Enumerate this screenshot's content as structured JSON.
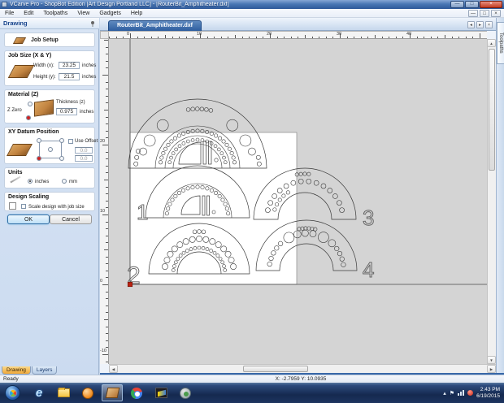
{
  "window": {
    "title": "VCarve Pro - ShopBot Edition [Art Design Portland LLC] - [RouterBit_Amphitheater.dxf]",
    "menus": [
      "File",
      "Edit",
      "Toolpaths",
      "View",
      "Gadgets",
      "Help"
    ],
    "controls": {
      "minimize": "—",
      "maximize": "□",
      "close": "×"
    }
  },
  "panel": {
    "header": "Drawing",
    "job_setup_label": "Job Setup",
    "job_size": {
      "title": "Job Size (X & Y)",
      "width_label": "Width (x):",
      "width_value": "23.25",
      "height_label": "Height (y):",
      "height_value": "21.5",
      "units_label": "inches"
    },
    "material": {
      "title": "Material (Z)",
      "z_zero_label": "Z Zero",
      "thickness_label": "Thickness (z)",
      "thickness_value": "0.975",
      "units_label": "inches"
    },
    "datum": {
      "title": "XY Datum Position",
      "use_offset_label": "Use Offset",
      "x_offset_value": "0.0",
      "y_offset_value": "0.0"
    },
    "units": {
      "title": "Units",
      "inches_label": "inches",
      "mm_label": "mm"
    },
    "design_scaling": {
      "title": "Design Scaling",
      "checkbox_label": "Scale design with job size"
    },
    "ok_label": "OK",
    "cancel_label": "Cancel",
    "bottom_tabs": {
      "drawing": "Drawing",
      "layers": "Layers"
    }
  },
  "canvas": {
    "document_tab": "RouterBit_Amphitheater.dxf",
    "toolpaths_tab": "Toolpaths",
    "ruler_h_labels": [
      "0",
      "10",
      "20",
      "30",
      "40"
    ],
    "ruler_v_labels": [
      "20",
      "10",
      "0",
      "-10"
    ],
    "part_labels": [
      "1",
      "2",
      "3",
      "4"
    ]
  },
  "status": {
    "ready": "Ready",
    "coordinates": "X: -2.7959 Y: 10.0935"
  },
  "taskbar": {
    "time": "2:43 PM",
    "date": "6/19/2015",
    "icons": [
      "start",
      "internet-explorer",
      "windows-explorer",
      "media-player",
      "vcarve-pro-active",
      "chrome",
      "cam-software",
      "utility"
    ]
  },
  "colors": {
    "accent_blue": "#2d5d9f",
    "datum_red": "#bb2211",
    "canvas_gray": "#d4d4d4",
    "active_tab_orange": "#f0a839"
  }
}
